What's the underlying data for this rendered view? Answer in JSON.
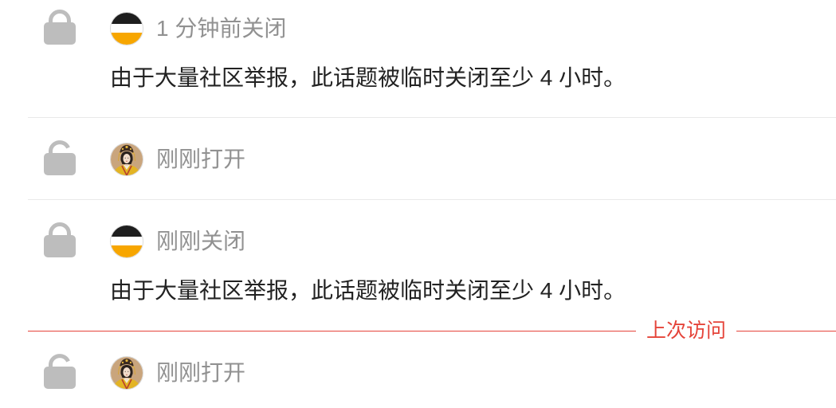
{
  "colors": {
    "icon": "#bdbdbd",
    "muted_text": "#919191",
    "body_text": "#222222",
    "divider": "#e9e9e9",
    "last_visit": "#e5443a"
  },
  "timeline": {
    "posts": [
      {
        "icon": "lock-icon",
        "avatar_icon": "flag-avatar",
        "label": "1 分钟前关闭",
        "message": "由于大量社区举报，此话题被临时关闭至少 4 小时。"
      },
      {
        "icon": "unlock-icon",
        "avatar_icon": "portrait-avatar",
        "label": "刚刚打开"
      },
      {
        "icon": "lock-icon",
        "avatar_icon": "flag-avatar",
        "label": "刚刚关闭",
        "message": "由于大量社区举报，此话题被临时关闭至少 4 小时。"
      },
      {
        "icon": "unlock-icon",
        "avatar_icon": "portrait-avatar",
        "label": "刚刚打开"
      }
    ],
    "last_visit_label": "上次访问"
  }
}
